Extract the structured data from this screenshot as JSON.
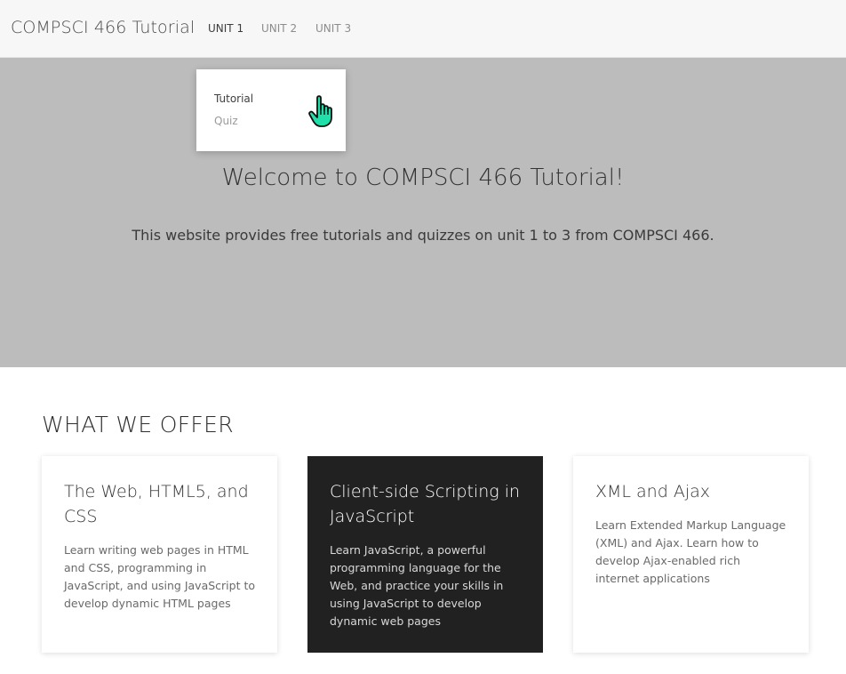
{
  "navbar": {
    "brand": "COMPSCI 466 Tutorial",
    "items": [
      {
        "label": "UNIT 1",
        "active": true
      },
      {
        "label": "UNIT 2",
        "active": false
      },
      {
        "label": "UNIT 3",
        "active": false
      }
    ]
  },
  "dropdown": {
    "items": [
      "Tutorial",
      "Quiz"
    ]
  },
  "cursor_icon": "hand-pointer-icon",
  "hero": {
    "title": "Welcome to COMPSCI 466 Tutorial!",
    "text": "This website provides free tutorials and quizzes on unit 1 to 3 from COMPSCI 466."
  },
  "offer": {
    "heading": "WHAT WE OFFER",
    "cards": [
      {
        "title": "The Web, HTML5, and CSS",
        "desc": "Learn writing web pages in HTML and CSS, programming in JavaScript, and using JavaScript to develop dynamic HTML pages"
      },
      {
        "title": "Client-side Scripting in JavaScript",
        "desc": "Learn JavaScript, a powerful programming language for the Web, and practice your skills in using JavaScript to develop dynamic web pages"
      },
      {
        "title": "XML and Ajax",
        "desc": "Learn Extended Markup Language (XML) and Ajax. Learn how to develop Ajax-enabled rich internet applications"
      }
    ]
  },
  "colors": {
    "navbar_bg": "#f7f7f7",
    "hero_bg": "#bcbcbc",
    "dark_card_bg": "#212121",
    "cursor_fill": "#1fe0a8"
  }
}
